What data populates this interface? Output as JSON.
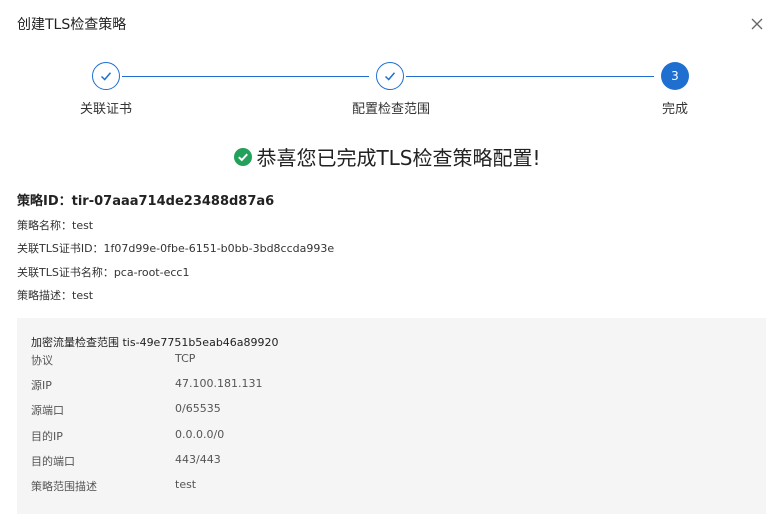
{
  "dialog": {
    "title": "创建TLS检查策略",
    "close_icon": "close-icon"
  },
  "steps": [
    {
      "label": "关联证书",
      "state": "done"
    },
    {
      "label": "配置检查范围",
      "state": "done"
    },
    {
      "label": "完成",
      "state": "active",
      "number": "3"
    }
  ],
  "success": {
    "icon": "check-circle-icon",
    "message": "恭喜您已完成TLS检查策略配置!"
  },
  "policy": {
    "id_line": "策略ID：tir-07aaa714de23488d87a6",
    "name_line": "策略名称：test",
    "cert_id_line": "关联TLS证书ID：1f07d99e-0fbe-6151-b0bb-3bd8ccda993e",
    "cert_name_line": "关联TLS证书名称：pca-root-ecc1",
    "desc_line": "策略描述：test"
  },
  "scope": {
    "title": "加密流量检查范围 tis-49e7751b5eab46a89920",
    "rows": [
      {
        "key": "协议",
        "value": "TCP"
      },
      {
        "key": "源IP",
        "value": "47.100.181.131"
      },
      {
        "key": "源端口",
        "value": "0/65535"
      },
      {
        "key": "目的IP",
        "value": "0.0.0.0/0"
      },
      {
        "key": "目的端口",
        "value": "443/443"
      },
      {
        "key": "策略范围描述",
        "value": "test"
      }
    ]
  },
  "colors": {
    "primary": "#1f6fd1",
    "success": "#23a15b"
  }
}
